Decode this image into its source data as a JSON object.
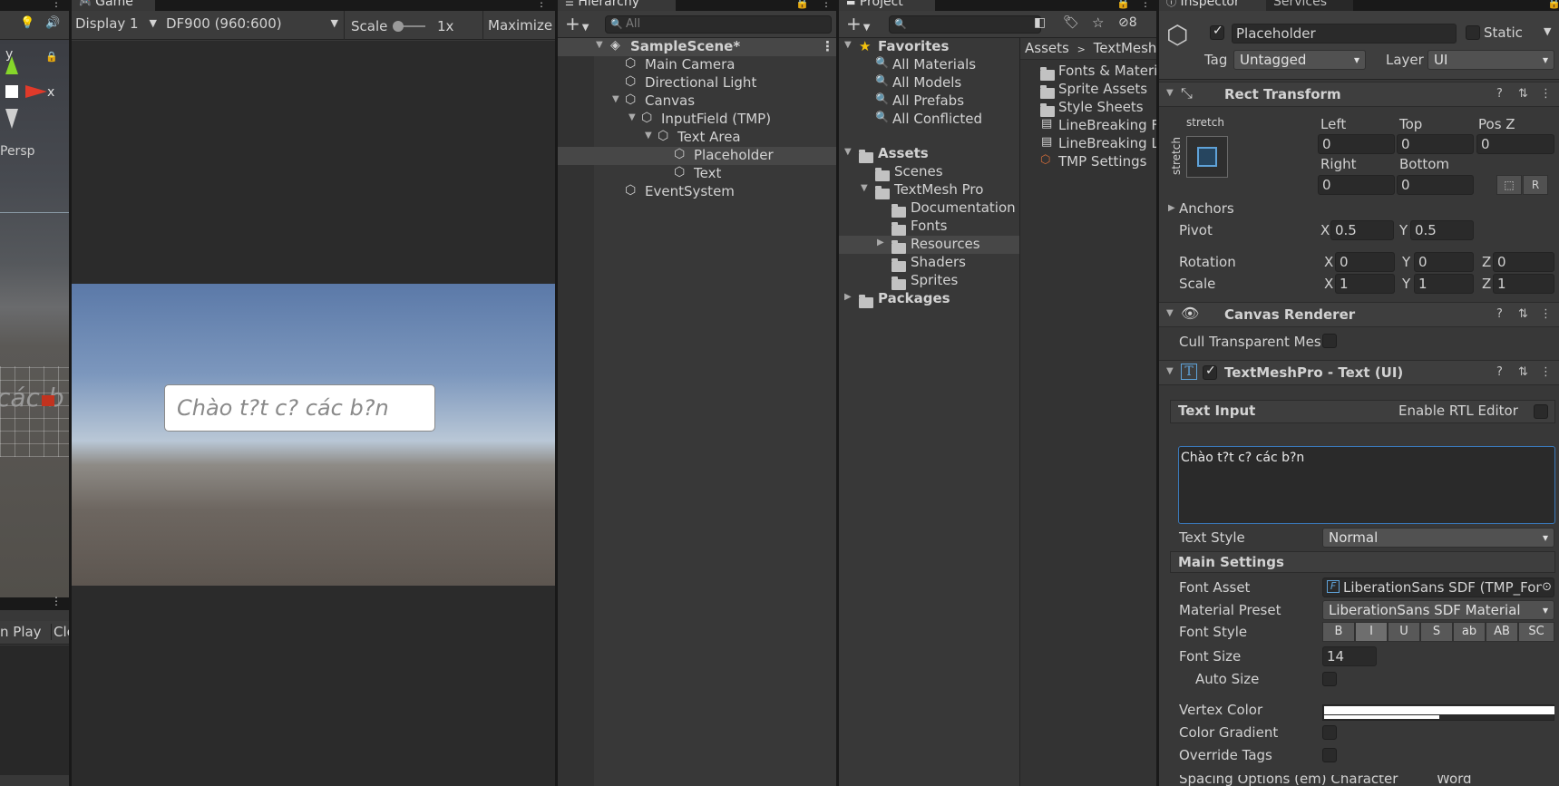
{
  "scene": {
    "persp_label": "Persp",
    "axis_x": "x",
    "axis_y": "y",
    "ghost_text": "các b",
    "btn_on_play": "n Play",
    "btn_clear": "Cle"
  },
  "game": {
    "tab": "Game",
    "display": "Display 1",
    "resolution": "DF900 (960:600)",
    "scale_label": "Scale",
    "scale_value": "1x",
    "maximize": "Maximize",
    "input_placeholder": "Chào t?t c? các b?n"
  },
  "hierarchy": {
    "tab": "Hierarchy",
    "search_placeholder": "All",
    "scene": "SampleScene*",
    "items": [
      "Main Camera",
      "Directional Light",
      "Canvas",
      "InputField (TMP)",
      "Text Area",
      "Placeholder",
      "Text",
      "EventSystem"
    ]
  },
  "project": {
    "tab": "Project",
    "hidden_count": "8",
    "favorites": {
      "label": "Favorites",
      "items": [
        "All Materials",
        "All Models",
        "All Prefabs",
        "All Conflicted"
      ]
    },
    "assets": {
      "label": "Assets",
      "items": [
        "Scenes",
        "TextMesh Pro",
        "Documentation",
        "Fonts",
        "Resources",
        "Shaders",
        "Sprites"
      ]
    },
    "packages": "Packages",
    "breadcrumb": [
      "Assets",
      "TextMesh"
    ],
    "files": [
      "Fonts & Materia",
      "Sprite Assets",
      "Style Sheets",
      "LineBreaking F",
      "LineBreaking L",
      "TMP Settings"
    ]
  },
  "inspector": {
    "tab": "Inspector",
    "tab2": "Services",
    "object_name": "Placeholder",
    "static_label": "Static",
    "tag_label": "Tag",
    "tag_value": "Untagged",
    "layer_label": "Layer",
    "layer_value": "UI",
    "rect": {
      "title": "Rect Transform",
      "stretch_top": "stretch",
      "stretch_side": "stretch",
      "left_label": "Left",
      "left": "0",
      "top_label": "Top",
      "top": "0",
      "posz_label": "Pos Z",
      "posz": "0",
      "right_label": "Right",
      "right": "0",
      "bottom_label": "Bottom",
      "bottom": "0",
      "anchors": "Anchors",
      "pivot_label": "Pivot",
      "pivot_x": "0.5",
      "pivot_y": "0.5",
      "rotation_label": "Rotation",
      "rot_x": "0",
      "rot_y": "0",
      "rot_z": "0",
      "scale_label": "Scale",
      "scale_x": "1",
      "scale_y": "1",
      "scale_z": "1",
      "x": "X",
      "y": "Y",
      "z": "Z"
    },
    "canvas_renderer": {
      "title": "Canvas Renderer",
      "cull": "Cull Transparent Mesh"
    },
    "tmp": {
      "title": "TextMeshPro - Text (UI)",
      "text_input": "Text Input",
      "rtl": "Enable RTL Editor",
      "text_value": "Chào t?t c? các b?n",
      "text_style_label": "Text Style",
      "text_style": "Normal",
      "main_settings": "Main Settings",
      "font_asset_label": "Font Asset",
      "font_asset": "LiberationSans SDF (TMP_Font",
      "material_label": "Material Preset",
      "material": "LiberationSans SDF Material",
      "font_style_label": "Font Style",
      "font_styles": [
        "B",
        "I",
        "U",
        "S",
        "ab",
        "AB",
        "SC"
      ],
      "font_size_label": "Font Size",
      "font_size": "14",
      "auto_size": "Auto Size",
      "vertex_color": "Vertex Color",
      "color_gradient": "Color Gradient",
      "override_tags": "Override Tags",
      "spacing": "Spacing Options (em) Character",
      "word": "Word"
    }
  },
  "colors": {
    "accent_blue": "#3a79bb",
    "panel": "#383838",
    "selected": "#474747",
    "red_axis": "#e03a2a",
    "green_axis": "#86d62a"
  }
}
